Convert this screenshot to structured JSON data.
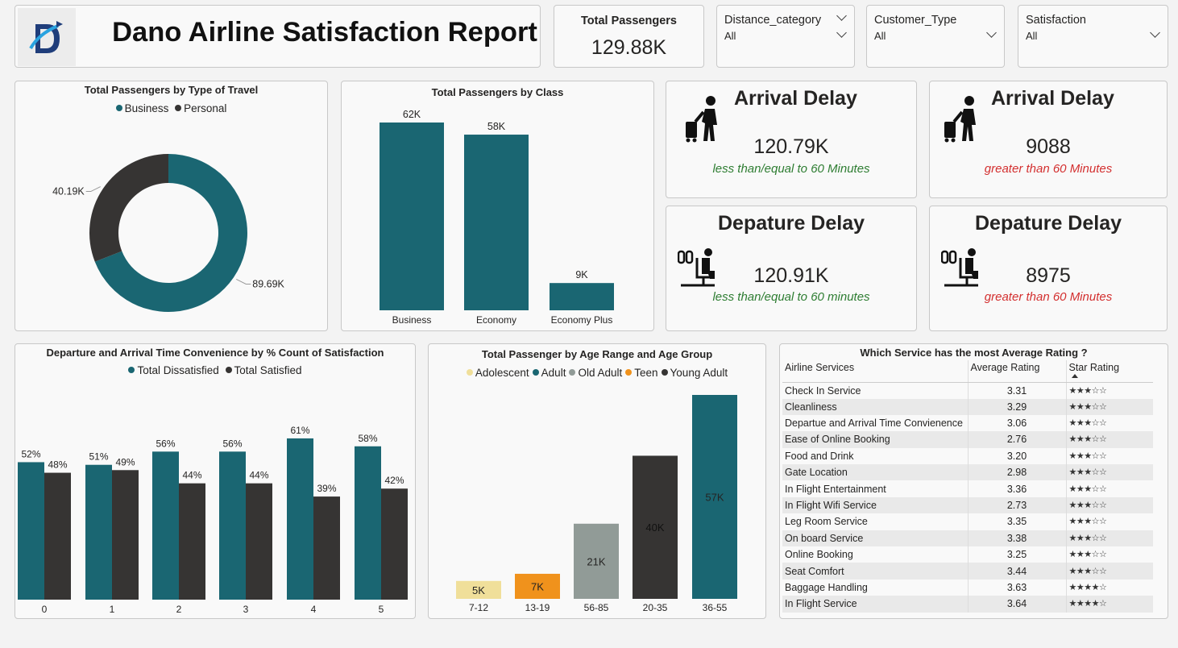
{
  "header": {
    "title": "Dano Airline Satisfaction Report",
    "logo_letter": "D"
  },
  "kpi": {
    "label": "Total Passengers",
    "value": "129.88K"
  },
  "slicers": [
    {
      "label": "Distance_category",
      "value": "All"
    },
    {
      "label": "Customer_Type",
      "value": "All"
    },
    {
      "label": "Satisfaction",
      "value": "All"
    }
  ],
  "delays": {
    "arrival_ok": {
      "title": "Arrival Delay",
      "value": "120.79K",
      "sub": "less than/equal to 60 Minutes",
      "icon": "traveler-luggage-icon"
    },
    "arrival_bad": {
      "title": "Arrival Delay",
      "value": "9088",
      "sub": "greater than 60 Minutes",
      "icon": "traveler-luggage-icon"
    },
    "departure_ok": {
      "title": "Depature Delay",
      "value": "120.91K",
      "sub": "less than/equal to 60 minutes",
      "icon": "seated-passenger-icon"
    },
    "departure_bad": {
      "title": "Depature Delay",
      "value": "8975",
      "sub": "greater than 60 Minutes",
      "icon": "seated-passenger-icon"
    }
  },
  "colors": {
    "teal": "#1a6672",
    "dark": "#363433",
    "adolescent": "#f0df9a",
    "teen": "#f0921c",
    "old_adult": "#919b97",
    "ok_green": "#2e7d32",
    "bad_red": "#d32f2f"
  },
  "chart_data": [
    {
      "type": "pie",
      "variant": "donut",
      "title": "Total Passengers by Type of Travel",
      "legend_position": "top",
      "slices": [
        {
          "name": "Business",
          "value": 89.69,
          "label": "89.69K",
          "color": "#1a6672"
        },
        {
          "name": "Personal",
          "value": 40.19,
          "label": "40.19K",
          "color": "#363433"
        }
      ]
    },
    {
      "type": "bar",
      "title": "Total Passengers by Class",
      "categories": [
        "Business",
        "Economy",
        "Economy Plus"
      ],
      "values": [
        62,
        58,
        9
      ],
      "labels": [
        "62K",
        "58K",
        "9K"
      ],
      "color": "#1a6672"
    },
    {
      "type": "bar",
      "title": "Departure and Arrival Time Convenience by % Count of Satisfaction",
      "legend_position": "top",
      "categories": [
        "0",
        "1",
        "2",
        "3",
        "4",
        "5"
      ],
      "series": [
        {
          "name": "Total Dissatisfied",
          "values": [
            52,
            51,
            56,
            56,
            61,
            58
          ],
          "color": "#1a6672"
        },
        {
          "name": "Total Satisfied",
          "values": [
            48,
            49,
            44,
            44,
            39,
            42
          ],
          "color": "#363433"
        }
      ],
      "unit": "%"
    },
    {
      "type": "bar",
      "title": "Total Passenger by Age Range and Age Group",
      "legend_position": "top",
      "legend": [
        {
          "name": "Adolescent",
          "color": "#f0df9a"
        },
        {
          "name": "Adult",
          "color": "#1a6672"
        },
        {
          "name": "Old Adult",
          "color": "#919b97"
        },
        {
          "name": "Teen",
          "color": "#f0921c"
        },
        {
          "name": "Young Adult",
          "color": "#363433"
        }
      ],
      "categories": [
        "7-12",
        "13-19",
        "56-85",
        "20-35",
        "36-55"
      ],
      "values": [
        5,
        7,
        21,
        40,
        57
      ],
      "labels": [
        "5K",
        "7K",
        "21K",
        "40K",
        "57K"
      ],
      "groups": [
        "Adolescent",
        "Teen",
        "Old Adult",
        "Young Adult",
        "Adult"
      ]
    },
    {
      "type": "table",
      "title": "Which Service has the most Average Rating ?",
      "columns": [
        "Airline Services",
        "Average Rating",
        "Star Rating"
      ],
      "rows": [
        {
          "service": "Check In Service",
          "rating": "3.31",
          "stars": "★★★☆☆"
        },
        {
          "service": "Cleanliness",
          "rating": "3.29",
          "stars": "★★★☆☆"
        },
        {
          "service": "Departue and Arrival Time Convienence",
          "rating": "3.06",
          "stars": "★★★☆☆"
        },
        {
          "service": "Ease of Online Booking",
          "rating": "2.76",
          "stars": "★★★☆☆"
        },
        {
          "service": "Food and Drink",
          "rating": "3.20",
          "stars": "★★★☆☆"
        },
        {
          "service": "Gate Location",
          "rating": "2.98",
          "stars": "★★★☆☆"
        },
        {
          "service": "In Flight Entertainment",
          "rating": "3.36",
          "stars": "★★★☆☆"
        },
        {
          "service": "In Flight Wifi Service",
          "rating": "2.73",
          "stars": "★★★☆☆"
        },
        {
          "service": "Leg Room Service",
          "rating": "3.35",
          "stars": "★★★☆☆"
        },
        {
          "service": "On board Service",
          "rating": "3.38",
          "stars": "★★★☆☆"
        },
        {
          "service": "Online Booking",
          "rating": "3.25",
          "stars": "★★★☆☆"
        },
        {
          "service": "Seat Comfort",
          "rating": "3.44",
          "stars": "★★★☆☆"
        },
        {
          "service": "Baggage Handling",
          "rating": "3.63",
          "stars": "★★★★☆"
        },
        {
          "service": "In Flight Service",
          "rating": "3.64",
          "stars": "★★★★☆"
        }
      ]
    }
  ]
}
